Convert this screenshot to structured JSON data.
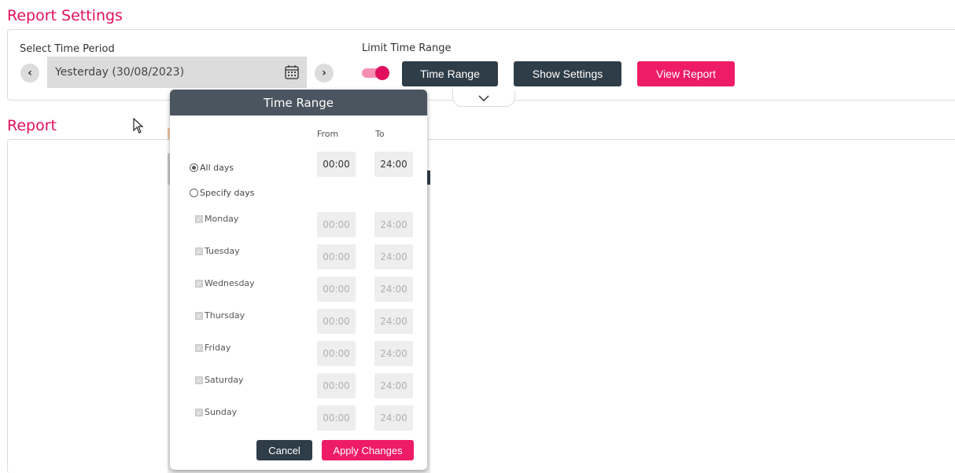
{
  "settings": {
    "title": "Report Settings",
    "period_label": "Select Time Period",
    "date_value": "Yesterday (30/08/2023)",
    "limit_label": "Limit Time Range",
    "limit_enabled": true,
    "btn_time_range": "Time Range",
    "btn_show_settings": "Show Settings",
    "btn_view_report": "View Report"
  },
  "report": {
    "title": "Report"
  },
  "popup": {
    "title": "Time Range",
    "from_label": "From",
    "to_label": "To",
    "all_days_label": "All days",
    "specify_days_label": "Specify days",
    "all_days_from": "00:00",
    "all_days_to": "24:00",
    "days": [
      {
        "name": "Monday",
        "from": "00:00",
        "to": "24:00"
      },
      {
        "name": "Tuesday",
        "from": "00:00",
        "to": "24:00"
      },
      {
        "name": "Wednesday",
        "from": "00:00",
        "to": "24:00"
      },
      {
        "name": "Thursday",
        "from": "00:00",
        "to": "24:00"
      },
      {
        "name": "Friday",
        "from": "00:00",
        "to": "24:00"
      },
      {
        "name": "Saturday",
        "from": "00:00",
        "to": "24:00"
      },
      {
        "name": "Sunday",
        "from": "00:00",
        "to": "24:00"
      }
    ],
    "cancel_label": "Cancel",
    "apply_label": "Apply Changes"
  },
  "colors": {
    "accent": "#e0105e",
    "dark_button": "#2f3d48",
    "popup_header": "#4b5560"
  }
}
